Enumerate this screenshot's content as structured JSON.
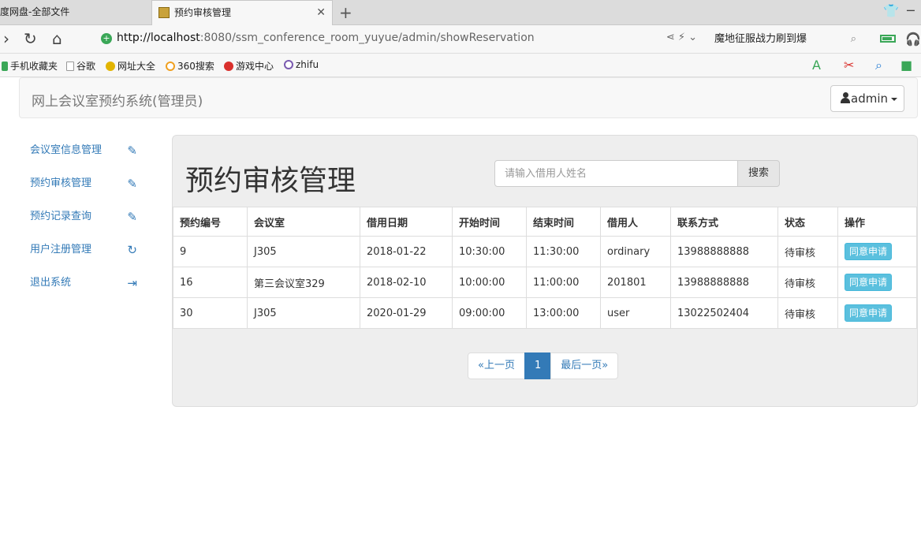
{
  "browser": {
    "tabs": [
      {
        "title": "度网盘-全部文件",
        "active": false
      },
      {
        "title": "预约审核管理",
        "active": true
      }
    ],
    "url_host": "http://localhost",
    "url_rest": ":8080/ssm_conference_room_yuyue/admin/showReservation",
    "search_text": "魔地征服战力刷到爆",
    "bookmarks": [
      "手机收藏夹",
      "谷歌",
      "网址大全",
      "360搜索",
      "游戏中心",
      "zhifu"
    ]
  },
  "navbar": {
    "brand": "网上会议室预约系统(管理员)",
    "user_label": "admin"
  },
  "sidebar": {
    "items": [
      {
        "label": "会议室信息管理",
        "icon": "pencil-icon"
      },
      {
        "label": "预约审核管理",
        "icon": "pencil-icon"
      },
      {
        "label": "预约记录查询",
        "icon": "pencil-icon"
      },
      {
        "label": "用户注册管理",
        "icon": "refresh-icon"
      },
      {
        "label": "退出系统",
        "icon": "logout-icon"
      }
    ]
  },
  "main": {
    "title": "预约审核管理",
    "search_placeholder": "请输入借用人姓名",
    "search_button": "搜索",
    "columns": [
      "预约编号",
      "会议室",
      "借用日期",
      "开始时间",
      "结束时间",
      "借用人",
      "联系方式",
      "状态",
      "操作"
    ],
    "rows": [
      {
        "id": "9",
        "room": "J305",
        "date": "2018-01-22",
        "start": "10:30:00",
        "end": "11:30:00",
        "user": "ordinary",
        "phone": "13988888888",
        "status": "待审核",
        "action": "同意申请"
      },
      {
        "id": "16",
        "room": "第三会议室329",
        "date": "2018-02-10",
        "start": "10:00:00",
        "end": "11:00:00",
        "user": "201801",
        "phone": "13988888888",
        "status": "待审核",
        "action": "同意申请"
      },
      {
        "id": "30",
        "room": "J305",
        "date": "2020-01-29",
        "start": "09:00:00",
        "end": "13:00:00",
        "user": "user",
        "phone": "13022502404",
        "status": "待审核",
        "action": "同意申请"
      }
    ],
    "pager": {
      "prev": "«上一页",
      "current": "1",
      "last": "最后一页»"
    }
  }
}
